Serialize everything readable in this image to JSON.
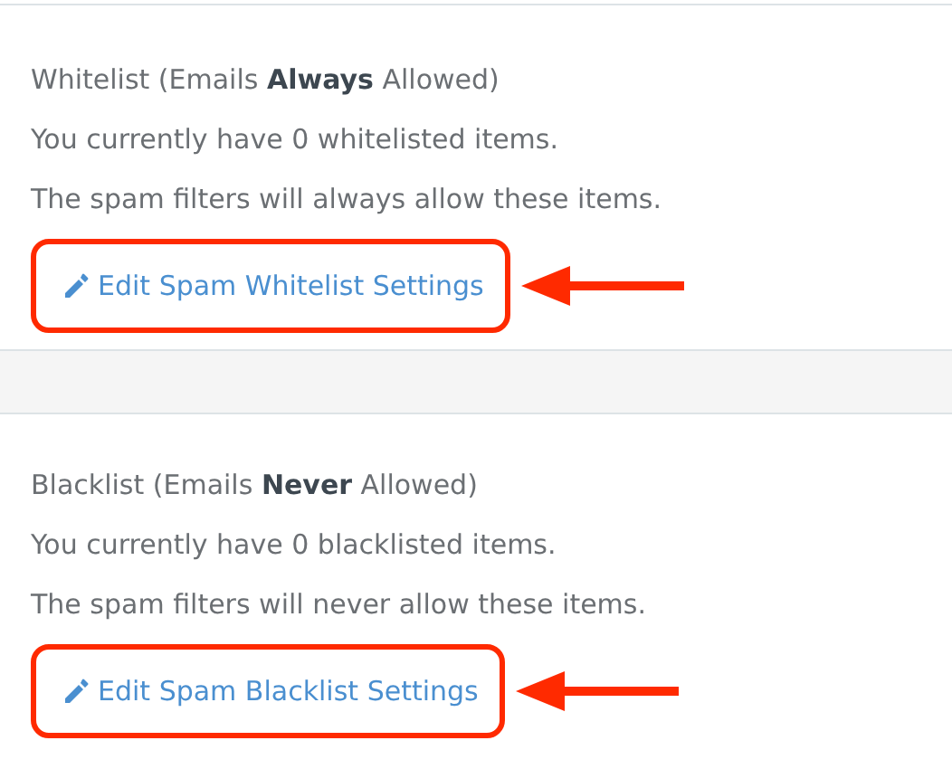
{
  "sections": [
    {
      "title": "Whitelist (Emails **Always** Allowed)",
      "lines": [
        "You currently have 0 whitelisted items.",
        "The spam filters will always allow these items."
      ],
      "link": "Edit Spam Whitelist Settings",
      "highlighted": true
    },
    {
      "title": "Blacklist (Emails **Never** Allowed)",
      "lines": [
        "You currently have 0 blacklisted items.",
        "The spam filters will never allow these items."
      ],
      "link": "Edit Spam Blacklist Settings",
      "highlighted": true
    }
  ]
}
